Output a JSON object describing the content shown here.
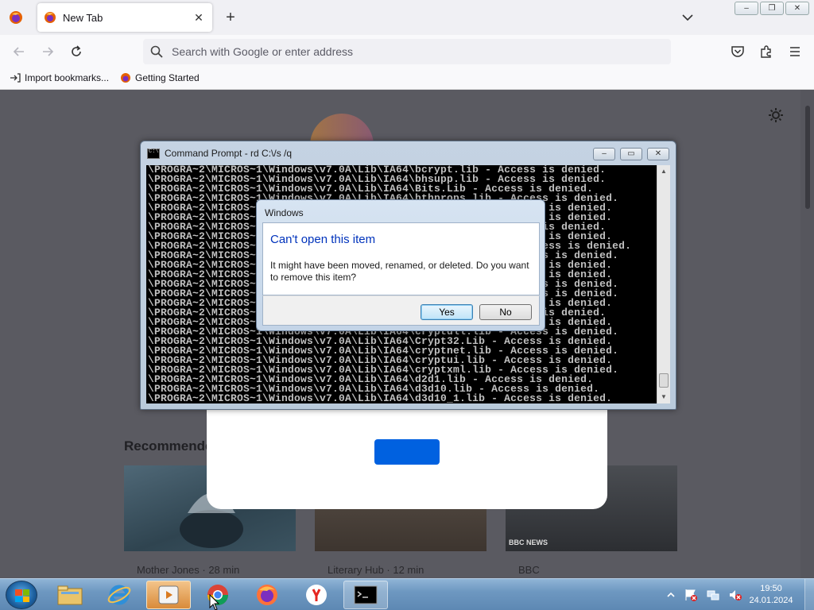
{
  "browser": {
    "tab_title": "New Tab",
    "close_tab_glyph": "✕",
    "new_tab_glyph": "+",
    "search_placeholder": "Search with Google or enter address",
    "bookmarks": [
      {
        "label": "Import bookmarks...",
        "icon": "import-icon"
      },
      {
        "label": "Getting Started",
        "icon": "firefox-icon"
      }
    ],
    "window_buttons": [
      "–",
      "❐",
      "✕"
    ]
  },
  "newtab": {
    "recommended_label": "Recommende",
    "cards": [
      {
        "meta": "Mother Jones · 28 min"
      },
      {
        "meta": "Literary Hub · 12 min"
      },
      {
        "meta": "BBC"
      }
    ],
    "bbc_badge": "BBC NEWS"
  },
  "cmd": {
    "title": "Command Prompt - rd  C:\\/s /q",
    "buttons": [
      "–",
      "▭",
      "✕"
    ],
    "lines": [
      "\\PROGRA~2\\MICROS~1\\Windows\\v7.0A\\Lib\\IA64\\bcrypt.lib - Access is denied.",
      "\\PROGRA~2\\MICROS~1\\Windows\\v7.0A\\Lib\\IA64\\bhsupp.lib - Access is denied.",
      "\\PROGRA~2\\MICROS~1\\Windows\\v7.0A\\Lib\\IA64\\Bits.Lib - Access is denied.",
      "\\PROGRA~2\\MICROS~1\\Windows\\v7.0A\\Lib\\IA64\\bthprops.lib - Access is denied.",
      "\\PROGRA~2\\MICROS~1\\Windows\\v7.0A\\Lib\\IA64\\cabinet.lib - Access is denied.",
      "\\PROGRA~2\\MICROS~1\\Windows\\v7.0A\\Lib\\IA64\\certadm.lib - Access is denied.",
      "\\PROGRA~2\\MICROS~1\\Windows\\v7.0A\\Lib\\IA64\\certca.lib - Access is denied.",
      "\\PROGRA~2\\MICROS~1\\Windows\\v7.0A\\Lib\\IA64\\certidl.lib - Access is denied.",
      "\\PROGRA~2\\MICROS~1\\Windows\\v7.0A\\Lib\\IA64\\certpoleng.lib - Access is denied.",
      "\\PROGRA~2\\MICROS~1\\Windows\\v7.0A\\Lib\\IA64\\cfgmgr32.lib - Access is denied.",
      "\\PROGRA~2\\MICROS~1\\Windows\\v7.0A\\Lib\\IA64\\clfsw32.lib - Access is denied.",
      "\\PROGRA~2\\MICROS~1\\Windows\\v7.0A\\Lib\\IA64\\clusapi.lib - Access is denied.",
      "\\PROGRA~2\\MICROS~1\\Windows\\v7.0A\\Lib\\IA64\\comctl32.lib - Access is denied.",
      "\\PROGRA~2\\MICROS~1\\Windows\\v7.0A\\Lib\\IA64\\comdlg32.lib - Access is denied.",
      "\\PROGRA~2\\MICROS~1\\Windows\\v7.0A\\Lib\\IA64\\comsupp.lib - Access is denied.",
      "\\PROGRA~2\\MICROS~1\\Windows\\v7.0A\\Lib\\IA64\\credui.lib - Access is denied.",
      "\\PROGRA~2\\MICROS~1\\Windows\\v7.0A\\Lib\\IA64\\crypt32.lib - Access is denied.",
      "\\PROGRA~2\\MICROS~1\\Windows\\v7.0A\\Lib\\IA64\\cryptdll.lib - Access is denied.",
      "\\PROGRA~2\\MICROS~1\\Windows\\v7.0A\\Lib\\IA64\\Crypt32.Lib - Access is denied.",
      "\\PROGRA~2\\MICROS~1\\Windows\\v7.0A\\Lib\\IA64\\cryptnet.lib - Access is denied.",
      "\\PROGRA~2\\MICROS~1\\Windows\\v7.0A\\Lib\\IA64\\cryptui.lib - Access is denied.",
      "\\PROGRA~2\\MICROS~1\\Windows\\v7.0A\\Lib\\IA64\\cryptxml.lib - Access is denied.",
      "\\PROGRA~2\\MICROS~1\\Windows\\v7.0A\\Lib\\IA64\\d2d1.lib - Access is denied.",
      "\\PROGRA~2\\MICROS~1\\Windows\\v7.0A\\Lib\\IA64\\d3d10.lib - Access is denied.",
      "\\PROGRA~2\\MICROS~1\\Windows\\v7.0A\\Lib\\IA64\\d3d10_1.lib - Access is denied."
    ]
  },
  "dialog": {
    "title": "Windows",
    "heading": "Can't open this item",
    "message": "It might have been moved, renamed, or deleted. Do you want to remove this item?",
    "yes_label": "Yes",
    "no_label": "No"
  },
  "taskbar": {
    "apps": [
      "file-explorer-icon",
      "internet-explorer-icon",
      "media-player-icon",
      "chrome-icon",
      "firefox-icon",
      "yandex-icon",
      "command-prompt-icon"
    ],
    "clock_time": "19:50",
    "clock_date": "24.01.2024",
    "tray": [
      "show-hidden-icons-icon",
      "action-center-icon",
      "network-icon",
      "volume-muted-icon"
    ]
  },
  "colors": {
    "firefox_accent": "#0061e0",
    "dialog_heading": "#0033bc",
    "taskbar": "#6e98c1"
  }
}
